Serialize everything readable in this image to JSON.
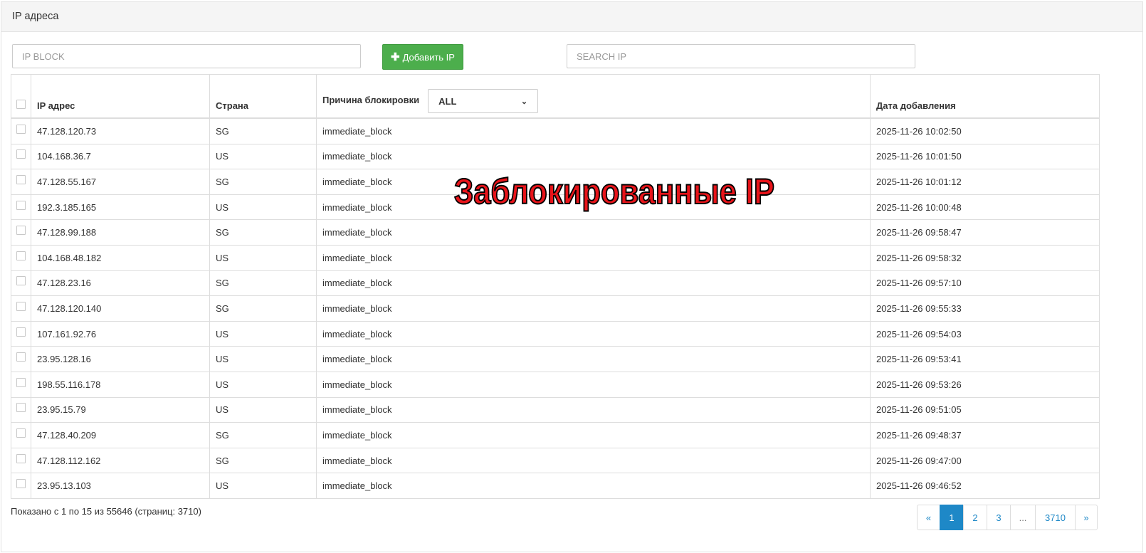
{
  "panel": {
    "title": "IP адреса"
  },
  "toolbar": {
    "ip_block_placeholder": "IP BLOCK",
    "add_button_label": "Добавить IP",
    "add_button_icon": "plus-icon",
    "search_placeholder": "SEARCH IP"
  },
  "table": {
    "headers": {
      "ip": "IP адрес",
      "country": "Страна",
      "reason": "Причина блокировки",
      "date": "Дата добавления"
    },
    "reason_filter": {
      "selected": "ALL"
    },
    "rows": [
      {
        "ip": "47.128.120.73",
        "country": "SG",
        "reason": "immediate_block",
        "date": "2025-11-26 10:02:50"
      },
      {
        "ip": "104.168.36.7",
        "country": "US",
        "reason": "immediate_block",
        "date": "2025-11-26 10:01:50"
      },
      {
        "ip": "47.128.55.167",
        "country": "SG",
        "reason": "immediate_block",
        "date": "2025-11-26 10:01:12"
      },
      {
        "ip": "192.3.185.165",
        "country": "US",
        "reason": "immediate_block",
        "date": "2025-11-26 10:00:48"
      },
      {
        "ip": "47.128.99.188",
        "country": "SG",
        "reason": "immediate_block",
        "date": "2025-11-26 09:58:47"
      },
      {
        "ip": "104.168.48.182",
        "country": "US",
        "reason": "immediate_block",
        "date": "2025-11-26 09:58:32"
      },
      {
        "ip": "47.128.23.16",
        "country": "SG",
        "reason": "immediate_block",
        "date": "2025-11-26 09:57:10"
      },
      {
        "ip": "47.128.120.140",
        "country": "SG",
        "reason": "immediate_block",
        "date": "2025-11-26 09:55:33"
      },
      {
        "ip": "107.161.92.76",
        "country": "US",
        "reason": "immediate_block",
        "date": "2025-11-26 09:54:03"
      },
      {
        "ip": "23.95.128.16",
        "country": "US",
        "reason": "immediate_block",
        "date": "2025-11-26 09:53:41"
      },
      {
        "ip": "198.55.116.178",
        "country": "US",
        "reason": "immediate_block",
        "date": "2025-11-26 09:53:26"
      },
      {
        "ip": "23.95.15.79",
        "country": "US",
        "reason": "immediate_block",
        "date": "2025-11-26 09:51:05"
      },
      {
        "ip": "47.128.40.209",
        "country": "SG",
        "reason": "immediate_block",
        "date": "2025-11-26 09:48:37"
      },
      {
        "ip": "47.128.112.162",
        "country": "SG",
        "reason": "immediate_block",
        "date": "2025-11-26 09:47:00"
      },
      {
        "ip": "23.95.13.103",
        "country": "US",
        "reason": "immediate_block",
        "date": "2025-11-26 09:46:52"
      }
    ]
  },
  "footer": {
    "info": "Показано с 1 по 15 из 55646 (страниц: 3710)",
    "pagination": [
      "«",
      "1",
      "2",
      "3",
      "...",
      "3710",
      "»"
    ],
    "active_page": "1"
  },
  "overlay": {
    "text": "Заблокированные IP",
    "fill": "#e8141a",
    "stroke": "#000000"
  },
  "colors": {
    "accent": "#1e88c7",
    "add_button": "#4cae4c"
  }
}
